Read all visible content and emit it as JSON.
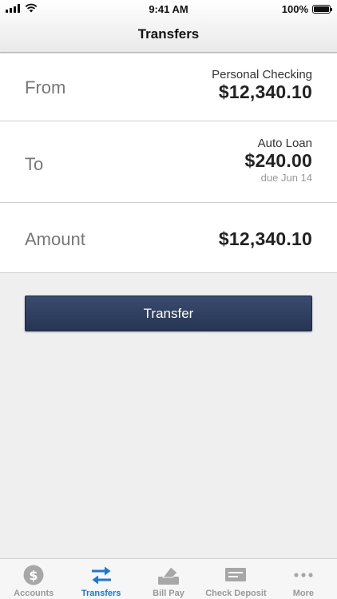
{
  "status_bar": {
    "time": "9:41 AM",
    "battery_percent": "100%",
    "battery_level": 1.0
  },
  "nav": {
    "title": "Transfers"
  },
  "transfer": {
    "from": {
      "label": "From",
      "account": "Personal Checking",
      "amount": "$12,340.10"
    },
    "to": {
      "label": "To",
      "account": "Auto Loan",
      "amount": "$240.00",
      "due": "due Jun 14"
    },
    "amount": {
      "label": "Amount",
      "value": "$12,340.10"
    },
    "button_label": "Transfer"
  },
  "tabs": [
    {
      "label": "Accounts",
      "icon": "dollar-circle-icon",
      "active": false
    },
    {
      "label": "Transfers",
      "icon": "transfer-arrows-icon",
      "active": true
    },
    {
      "label": "Bill Pay",
      "icon": "bill-pay-icon",
      "active": false
    },
    {
      "label": "Check Deposit",
      "icon": "check-icon",
      "active": false
    },
    {
      "label": "More",
      "icon": "more-dots-icon",
      "active": false
    }
  ],
  "colors": {
    "accent": "#1a78d4",
    "button": "#2e3d5e",
    "inactive_tab": "#999999"
  }
}
